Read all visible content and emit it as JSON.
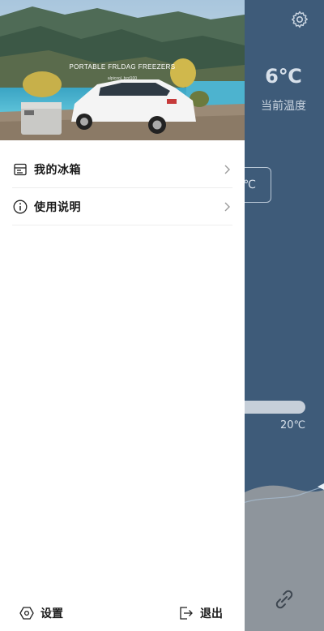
{
  "background": {
    "current_temp": "6℃",
    "current_temp_label": "当前温度",
    "set_temp_partial": "℃",
    "slider_max_label": "20℃"
  },
  "drawer": {
    "banner": {
      "title": "PORTABLE FRLDAG FREEZERS",
      "subtitle": "alpicool_bcd100"
    },
    "menu": [
      {
        "label": "我的冰箱",
        "icon": "fridge-list-icon"
      },
      {
        "label": "使用说明",
        "icon": "info-icon"
      }
    ],
    "footer": {
      "settings_label": "设置",
      "logout_label": "退出"
    }
  },
  "colors": {
    "app_background": "#3e5b79",
    "drawer_background": "#ffffff",
    "divider": "#ededed",
    "text_primary": "#1a1a1a"
  }
}
